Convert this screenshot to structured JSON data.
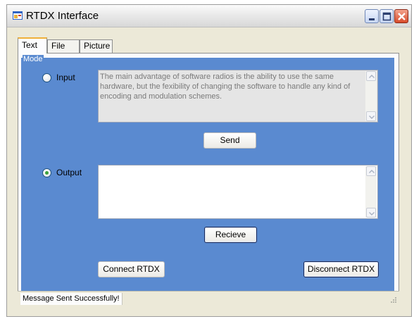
{
  "window": {
    "title": "RTDX Interface",
    "icons": {
      "app": "app-window-icon",
      "minimize": "minimize-icon",
      "maximize": "maximize-icon",
      "close": "close-icon"
    }
  },
  "tabs": [
    {
      "label": "Text",
      "selected": true
    },
    {
      "label": "File",
      "selected": false
    },
    {
      "label": "Picture",
      "selected": false
    }
  ],
  "mode": {
    "legend": "Mode",
    "input": {
      "label": "Input",
      "checked": false,
      "text": "The main advantage of software radios is the ability to use the same hardware, but the fexibility of changing the software to handle any kind of encoding and modulation schemes."
    },
    "send_label": "Send",
    "output": {
      "label": "Output",
      "checked": true,
      "text": ""
    },
    "receive_label": "Recieve"
  },
  "connect_label": "Connect RTDX",
  "disconnect_label": "Disconnect RTDX",
  "status": {
    "message": "Message Sent Successfully!"
  },
  "colors": {
    "panel_blue": "#5a8ad0",
    "radio_checked": "#3ba13b",
    "tab_highlight": "#f0b03a",
    "close_button": "#d84b2a"
  }
}
